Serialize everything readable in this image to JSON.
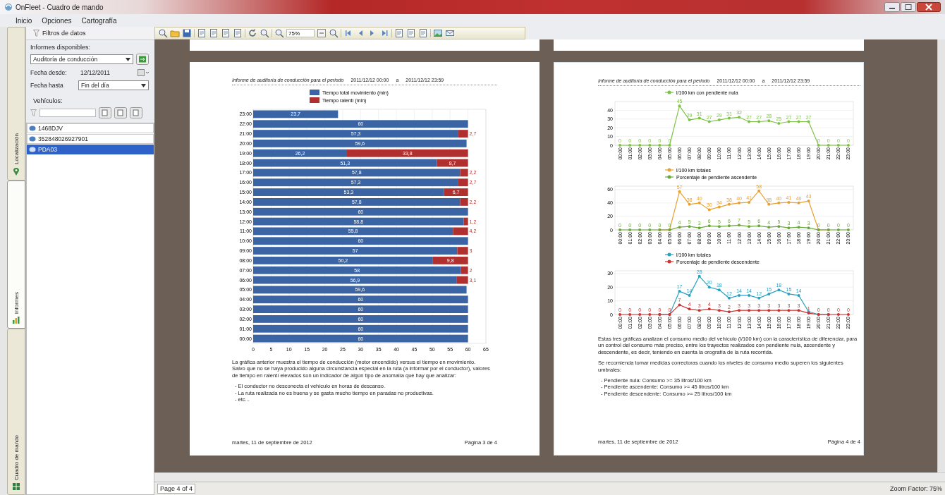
{
  "window": {
    "title": "OnFleet - Cuadro de mando"
  },
  "menu": [
    "Inicio",
    "Opciones",
    "Cartografía"
  ],
  "side_tabs": [
    {
      "label": "Localización",
      "kind": "map",
      "selected": false
    },
    {
      "label": "Informes",
      "kind": "report",
      "selected": true
    },
    {
      "label": "Cuadro de mando",
      "kind": "dashboard",
      "selected": false
    }
  ],
  "filters": {
    "title": "Filtros de datos",
    "reports_label": "Informes disponibles:",
    "report": "Auditoría de conducción",
    "from_label": "Fecha desde:",
    "from": "12/12/2011",
    "to_label": "Fecha hasta",
    "to": "Fin del día",
    "vehicles_label": "Vehículos:",
    "vehicles": [
      {
        "name": "1468DJV",
        "selected": false
      },
      {
        "name": "352848026927901",
        "selected": false
      },
      {
        "name": "PDA03",
        "selected": true
      }
    ]
  },
  "toolbar": {
    "zoom": "75%"
  },
  "pages": [
    {
      "header": {
        "title": "Informe de auditoría de conducción para el periodo",
        "from": "2011/12/12 00:00",
        "sep": "a",
        "to": "2011/12/12 23:59"
      },
      "charts": [
        {
          "chart_data": {
            "type": "bar",
            "orientation": "horizontal",
            "stacked": true,
            "grid": true,
            "legend": true,
            "categories": [
              "23:00",
              "22:00",
              "21:00",
              "20:00",
              "19:00",
              "18:00",
              "17:00",
              "16:00",
              "15:00",
              "14:00",
              "13:00",
              "12:00",
              "11:00",
              "10:00",
              "09:00",
              "08:00",
              "07:00",
              "06:00",
              "05:00",
              "04:00",
              "03:00",
              "02:00",
              "01:00",
              "00:00"
            ],
            "series": [
              {
                "name": "Tiempo total movimiento (min)",
                "color": "#3a64a4",
                "values": [
                  23.7,
                  60,
                  57.3,
                  59.6,
                  26.2,
                  51.3,
                  57.8,
                  57.3,
                  53.3,
                  57.8,
                  60,
                  58.8,
                  55.8,
                  60,
                  57,
                  50.2,
                  58,
                  56.9,
                  59.6,
                  60,
                  60,
                  60,
                  60,
                  60
                ]
              },
              {
                "name": "Tiempo ralentí (min)",
                "color": "#b03030",
                "values": [
                  0,
                  0,
                  2.7,
                  0,
                  33.8,
                  8.7,
                  2.2,
                  2.7,
                  6.7,
                  2.2,
                  0,
                  1.2,
                  4.2,
                  0,
                  3,
                  9.8,
                  2,
                  3.1,
                  0,
                  0,
                  0,
                  0,
                  0,
                  0
                ]
              }
            ],
            "value_labels": [
              [
                "23,7",
                "60",
                "57,3",
                "59,6",
                "26,2",
                "51,3",
                "57,8",
                "57,3",
                "53,3",
                "57,8",
                "60",
                "58,8",
                "55,8",
                "60",
                "57",
                "50,2",
                "58",
                "56,9",
                "59,6",
                "60",
                "60",
                "60",
                "60",
                "60"
              ],
              [
                null,
                null,
                "2,7",
                null,
                "33,8",
                "8,7",
                "2,2",
                "2,7",
                "6,7",
                "2,2",
                null,
                "1,2",
                "4,2",
                null,
                "3",
                "9,8",
                "2",
                "3,1",
                null,
                null,
                null,
                null,
                null,
                null
              ]
            ],
            "xlim": [
              0,
              65
            ],
            "xticks": [
              0,
              5,
              10,
              15,
              20,
              25,
              30,
              35,
              40,
              45,
              50,
              55,
              60,
              65
            ]
          }
        }
      ],
      "paragraphs": [
        "La gráfica anterior muestra el tiempo de conducción (motor encendido) versus el tiempo en movimiento.",
        "Salvo que no se haya producido alguna circunstancia especial en la ruta (a informar por el conductor), valores de tiempo en ralentí elevados son un indicador de algún tipo de anomalía que hay que analizar:"
      ],
      "bullets": [
        "- El conductor no desconecta el vehículo en horas de descanso.",
        "- La ruta realizada no es buena y se gasta mucho tiempo en paradas no productivas.",
        "- etc..."
      ],
      "footer": {
        "date": "martes, 11 de septiembre de 2012",
        "page": "Página 3 de 4"
      }
    },
    {
      "header": {
        "title": "Informe de auditoría de conducción para el periodo",
        "from": "2011/12/12 00:00",
        "sep": "a",
        "to": "2011/12/12 23:59"
      },
      "charts": [
        {
          "chart_data": {
            "type": "line",
            "grid": true,
            "legend": true,
            "categories": [
              "00:00",
              "01:00",
              "02:00",
              "03:00",
              "04:00",
              "05:00",
              "06:00",
              "07:00",
              "08:00",
              "09:00",
              "10:00",
              "11:00",
              "12:00",
              "13:00",
              "14:00",
              "15:00",
              "16:00",
              "17:00",
              "18:00",
              "19:00",
              "20:00",
              "21:00",
              "22:00",
              "23:00"
            ],
            "series": [
              {
                "name": "l/100 km con pendiente nula",
                "color": "#7cc242",
                "values": [
                  0,
                  0,
                  0,
                  0,
                  0,
                  0,
                  45,
                  29,
                  31,
                  27,
                  29,
                  31,
                  32,
                  27,
                  27,
                  28,
                  25,
                  27,
                  27,
                  27,
                  0,
                  0,
                  0,
                  0
                ]
              }
            ],
            "value_labels": [
              [
                "0",
                "0",
                "0",
                "0",
                "0",
                "0",
                "45",
                "29",
                "31",
                "27",
                "29",
                "31",
                "32",
                "27",
                "27",
                "28",
                "25",
                "27",
                "27",
                "27",
                "0",
                "0",
                "0",
                "0"
              ]
            ],
            "ylim": [
              0,
              50
            ],
            "yticks": [
              0,
              10,
              20,
              30,
              40
            ]
          }
        },
        {
          "chart_data": {
            "type": "line",
            "grid": true,
            "legend": true,
            "categories": [
              "00:00",
              "01:00",
              "02:00",
              "03:00",
              "04:00",
              "05:00",
              "06:00",
              "07:00",
              "08:00",
              "09:00",
              "10:00",
              "11:00",
              "12:00",
              "13:00",
              "14:00",
              "15:00",
              "16:00",
              "17:00",
              "18:00",
              "19:00",
              "20:00",
              "21:00",
              "22:00",
              "23:00"
            ],
            "series": [
              {
                "name": "l/100 km totales",
                "color": "#e8a030",
                "values": [
                  null,
                  null,
                  null,
                  null,
                  0,
                  0,
                  57,
                  38,
                  40,
                  30,
                  34,
                  38,
                  40,
                  41,
                  58,
                  38,
                  40,
                  41,
                  40,
                  43,
                  0,
                  0,
                  null,
                  null
                ]
              },
              {
                "name": "Porcentaje de pendiente ascendente",
                "color": "#6aa83a",
                "values": [
                  0,
                  0,
                  0,
                  0,
                  0,
                  0,
                  4,
                  5,
                  3,
                  6,
                  5,
                  6,
                  7,
                  5,
                  6,
                  4,
                  5,
                  3,
                  4,
                  3,
                  0,
                  0,
                  0,
                  0
                ]
              }
            ],
            "value_labels": [
              [
                null,
                null,
                null,
                null,
                null,
                null,
                "57",
                "38",
                "40",
                "30",
                "34",
                "38",
                "40",
                "41",
                "58",
                "38",
                "40",
                "41",
                "40",
                "43",
                null,
                null,
                null,
                null
              ],
              [
                "0",
                "0",
                "0",
                "0",
                "0",
                "0",
                "4",
                "5",
                "3",
                "6",
                "5",
                "6",
                "7",
                "5",
                "6",
                "4",
                "5",
                "3",
                "4",
                "3",
                "0",
                "0",
                "0",
                "0"
              ]
            ],
            "ylim": [
              0,
              65
            ],
            "yticks": [
              0,
              20,
              40,
              60
            ]
          }
        },
        {
          "chart_data": {
            "type": "line",
            "grid": true,
            "legend": true,
            "categories": [
              "00:00",
              "01:00",
              "02:00",
              "03:00",
              "04:00",
              "05:00",
              "06:00",
              "07:00",
              "08:00",
              "09:00",
              "10:00",
              "11:00",
              "12:00",
              "13:00",
              "14:00",
              "15:00",
              "16:00",
              "17:00",
              "18:00",
              "19:00",
              "20:00",
              "21:00",
              "22:00",
              "23:00"
            ],
            "series": [
              {
                "name": "l/100 km totales",
                "color": "#2aa0c0",
                "values": [
                  null,
                  null,
                  null,
                  null,
                  0,
                  0,
                  17,
                  14,
                  28,
                  20,
                  18,
                  12,
                  14,
                  14,
                  12,
                  15,
                  18,
                  15,
                  14,
                  2,
                  0,
                  0,
                  null,
                  null
                ]
              },
              {
                "name": "Porcentaje de pendiente descendente",
                "color": "#d03030",
                "values": [
                  0,
                  0,
                  0,
                  0,
                  0,
                  0,
                  7,
                  4,
                  3,
                  4,
                  3,
                  2,
                  3,
                  3,
                  3,
                  3,
                  3,
                  3,
                  3,
                  1,
                  0,
                  0,
                  0,
                  0
                ]
              }
            ],
            "value_labels": [
              [
                null,
                null,
                null,
                null,
                null,
                null,
                "17",
                "14",
                "28",
                "20",
                "18",
                "12",
                "14",
                "14",
                "12",
                "15",
                "18",
                "15",
                "14",
                null,
                null,
                null,
                null,
                null
              ],
              [
                "0",
                "0",
                "0",
                "0",
                "0",
                "0",
                "7",
                "4",
                "3",
                "4",
                "3",
                "2",
                "3",
                "3",
                "3",
                "3",
                "3",
                "3",
                "3",
                "1",
                "0",
                "0",
                "0",
                "0"
              ]
            ],
            "ylim": [
              0,
              32
            ],
            "yticks": [
              0,
              10,
              20,
              30
            ]
          }
        }
      ],
      "paragraphs": [
        "Estas tres gráficas analizan el consumo medio del vehículo (l/100 km) con la característica de diferenciar, para un control del consumo más preciso, entre los trayectos realizados con pendiente nula, ascendente y descendente, es decir, teniendo en cuenta la orografía de la ruta recorrida.",
        "Se recomienda tomar medidas correctoras cuando los niveles de consumo medio superen los siguientes umbrales:"
      ],
      "bullets": [
        "- Pendiente nula: Consumo >= 35 litros/100 km",
        "- Pendiente ascendente: Consumo >= 45 litros/100 km",
        "- Pendiente descendente: Consumo >= 25 litros/100 km"
      ],
      "footer": {
        "date": "martes, 11 de septiembre de 2012",
        "page": "Página 4 de 4"
      }
    }
  ],
  "status_bar": {
    "page": "Page 4 of 4",
    "zoom": "Zoom Factor: 75%"
  }
}
